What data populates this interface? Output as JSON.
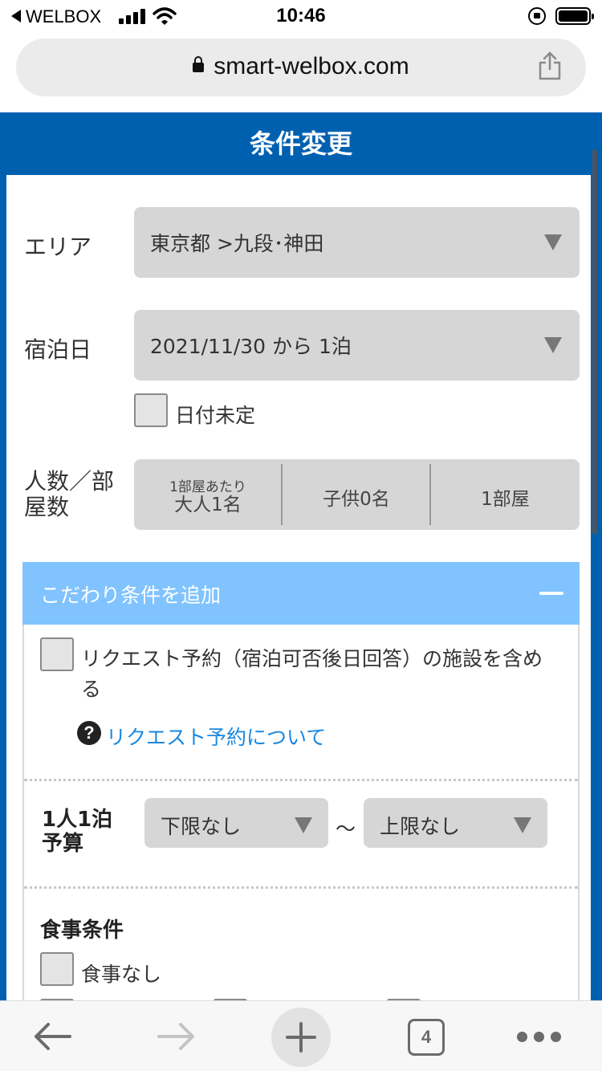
{
  "status_bar": {
    "carrier": "WELBOX",
    "time": "10:46"
  },
  "browser": {
    "url": "smart-welbox.com",
    "tab_count": "4"
  },
  "page": {
    "title": "条件変更",
    "area": {
      "label": "エリア",
      "value": "東京都 >九段･神田"
    },
    "stay_date": {
      "label": "宿泊日",
      "value": "2021/11/30 から 1泊"
    },
    "date_undecided": {
      "label": "日付未定",
      "checked": false
    },
    "guests": {
      "label_line1": "人数／部",
      "label_line2": "屋数",
      "per_room": "1部屋あたり",
      "adults": "大人1名",
      "children": "子供0名",
      "rooms": "1部屋"
    },
    "extra": {
      "header": "こだわり条件を追加",
      "request_checkbox": {
        "line1": "リクエスト予約（宿泊可否後日回答）の施設を含め",
        "line2": "る",
        "checked": false
      },
      "request_link": "リクエスト予約について",
      "budget": {
        "label_line1": "1人1泊",
        "label_line2": "予算",
        "min": "下限なし",
        "separator": "～",
        "max": "上限なし"
      },
      "meal": {
        "title": "食事条件",
        "no_meal": {
          "label": "食事なし",
          "checked": false
        }
      }
    }
  },
  "colors": {
    "brand_blue": "#0060b0",
    "accordion_blue": "#80c3ff",
    "link_blue": "#1a88e0"
  }
}
